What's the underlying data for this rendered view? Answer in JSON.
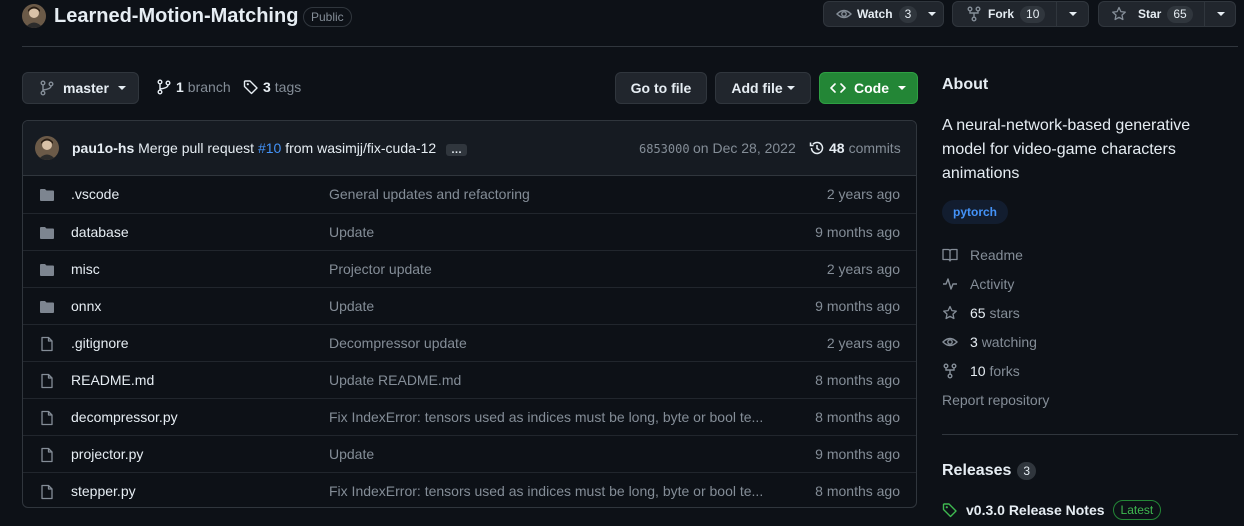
{
  "repo": {
    "name": "Learned-Motion-Matching",
    "visibility": "Public",
    "watch_label": "Watch",
    "watch_count": "3",
    "fork_label": "Fork",
    "fork_count": "10",
    "star_label": "Star",
    "star_count": "65"
  },
  "toolbar": {
    "branch_name": "master",
    "branch_count": "1",
    "branch_label": "branch",
    "tag_count": "3",
    "tag_label": "tags",
    "goto_file": "Go to file",
    "add_file": "Add file",
    "code": "Code"
  },
  "commit": {
    "author": "pau1o-hs",
    "message_prefix": "Merge pull request",
    "pr_link": "#10",
    "message_suffix": "from wasimjj/fix-cuda-12",
    "ellipsis": "…",
    "sha": "6853000",
    "date": "on Dec 28, 2022",
    "commits_count": "48",
    "commits_label": "commits"
  },
  "files": [
    {
      "type": "dir",
      "name": ".vscode",
      "message": "General updates and refactoring",
      "age": "2 years ago"
    },
    {
      "type": "dir",
      "name": "database",
      "message": "Update",
      "age": "9 months ago"
    },
    {
      "type": "dir",
      "name": "misc",
      "message": "Projector update",
      "age": "2 years ago"
    },
    {
      "type": "dir",
      "name": "onnx",
      "message": "Update",
      "age": "9 months ago"
    },
    {
      "type": "file",
      "name": ".gitignore",
      "message": "Decompressor update",
      "age": "2 years ago"
    },
    {
      "type": "file",
      "name": "README.md",
      "message": "Update README.md",
      "age": "8 months ago"
    },
    {
      "type": "file",
      "name": "decompressor.py",
      "message": "Fix IndexError: tensors used as indices must be long, byte or bool te...",
      "age": "8 months ago"
    },
    {
      "type": "file",
      "name": "projector.py",
      "message": "Update",
      "age": "9 months ago"
    },
    {
      "type": "file",
      "name": "stepper.py",
      "message": "Fix IndexError: tensors used as indices must be long, byte or bool te...",
      "age": "8 months ago"
    }
  ],
  "about": {
    "heading": "About",
    "description": "A neural-network-based generative model for video-game characters animations",
    "topic": "pytorch",
    "readme": "Readme",
    "activity": "Activity",
    "stars_count": "65",
    "stars_label": "stars",
    "watching_count": "3",
    "watching_label": "watching",
    "forks_count": "10",
    "forks_label": "forks",
    "report": "Report repository"
  },
  "releases": {
    "heading": "Releases",
    "count": "3",
    "latest_name": "v0.3.0 Release Notes",
    "latest_badge": "Latest"
  },
  "colors": {
    "background": "#0d1117",
    "accent_green": "#238636",
    "link_blue": "#4493f8",
    "muted": "#848d97"
  }
}
